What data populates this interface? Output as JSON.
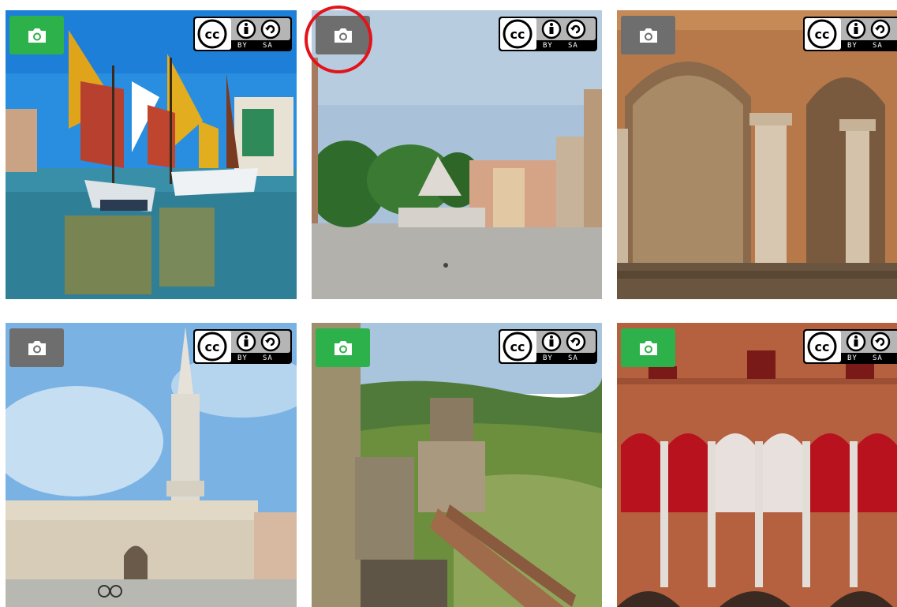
{
  "gallery": {
    "tiles": [
      {
        "id": "canal-boats",
        "camera_icon_color": "#2db14a",
        "license": {
          "by_label": "BY",
          "sa_label": "SA"
        }
      },
      {
        "id": "piazza-fountain",
        "camera_icon_color": "#6e6e6e",
        "license": {
          "by_label": "BY",
          "sa_label": "SA"
        }
      },
      {
        "id": "arcade-frescoes",
        "camera_icon_color": "#6e6e6e",
        "license": {
          "by_label": "BY",
          "sa_label": "SA"
        }
      },
      {
        "id": "cathedral-tower",
        "camera_icon_color": "#6e6e6e",
        "license": {
          "by_label": "BY",
          "sa_label": "SA"
        }
      },
      {
        "id": "castle-hills",
        "camera_icon_color": "#2db14a",
        "license": {
          "by_label": "BY",
          "sa_label": "SA"
        }
      },
      {
        "id": "brick-arches",
        "camera_icon_color": "#2db14a",
        "license": {
          "by_label": "BY",
          "sa_label": "SA"
        }
      }
    ]
  },
  "highlight": {
    "color": "#e3131b"
  }
}
